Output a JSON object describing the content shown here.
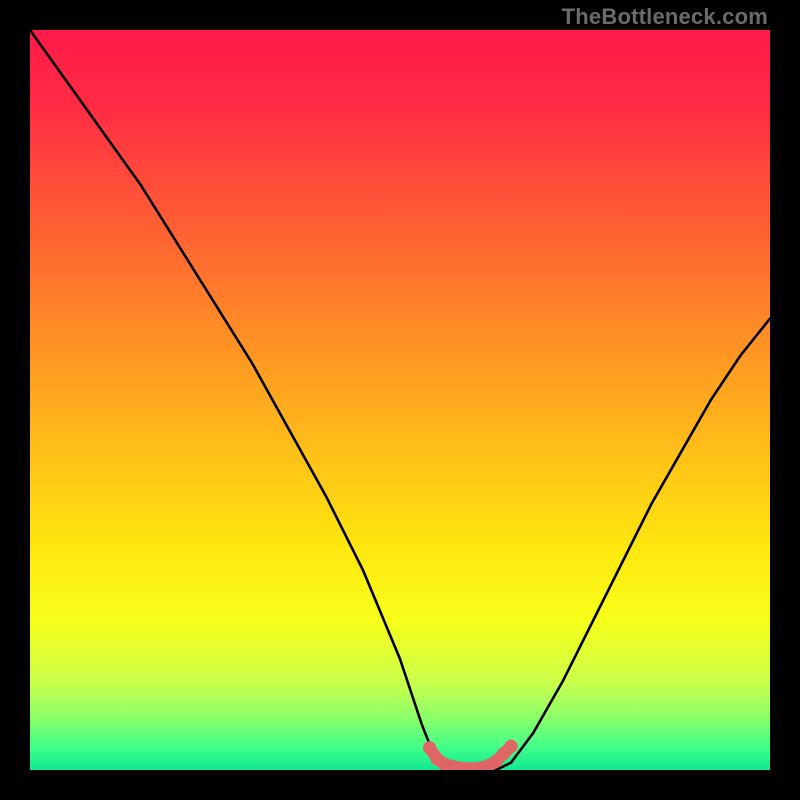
{
  "watermark": "TheBottleneck.com",
  "gradient_stops": [
    {
      "offset": 0.0,
      "color": "#ff1a4a"
    },
    {
      "offset": 0.1,
      "color": "#ff2b44"
    },
    {
      "offset": 0.25,
      "color": "#ff5a35"
    },
    {
      "offset": 0.4,
      "color": "#ff8a27"
    },
    {
      "offset": 0.55,
      "color": "#ffb91a"
    },
    {
      "offset": 0.7,
      "color": "#ffe70f"
    },
    {
      "offset": 0.8,
      "color": "#f6ff1a"
    },
    {
      "offset": 0.88,
      "color": "#ccff4a"
    },
    {
      "offset": 0.93,
      "color": "#8aff6a"
    },
    {
      "offset": 0.97,
      "color": "#40ff8a"
    },
    {
      "offset": 1.0,
      "color": "#10e890"
    }
  ],
  "chart_data": {
    "type": "line",
    "title": "",
    "xlabel": "",
    "ylabel": "",
    "xlim": [
      0,
      100
    ],
    "ylim": [
      0,
      100
    ],
    "series": [
      {
        "name": "left-curve",
        "x": [
          0,
          5,
          10,
          15,
          20,
          25,
          30,
          35,
          40,
          45,
          50,
          53,
          55
        ],
        "y": [
          100,
          93,
          86,
          79,
          71,
          63,
          55,
          46,
          37,
          27,
          15,
          6,
          1
        ]
      },
      {
        "name": "floor-segment",
        "x": [
          55,
          57,
          59,
          61,
          63,
          65
        ],
        "y": [
          1,
          0,
          0,
          0,
          0,
          1
        ]
      },
      {
        "name": "right-curve",
        "x": [
          65,
          68,
          72,
          76,
          80,
          84,
          88,
          92,
          96,
          100
        ],
        "y": [
          1,
          5,
          12,
          20,
          28,
          36,
          43,
          50,
          56,
          61
        ]
      }
    ],
    "marker": {
      "name": "bottom-marker",
      "color": "#e06666",
      "x": [
        54,
        55,
        56,
        57,
        58,
        59,
        60,
        61,
        62,
        63,
        64,
        65
      ],
      "y": [
        3,
        1.5,
        0.8,
        0.5,
        0.3,
        0.2,
        0.2,
        0.3,
        0.6,
        1.2,
        2.2,
        3.2
      ]
    }
  }
}
